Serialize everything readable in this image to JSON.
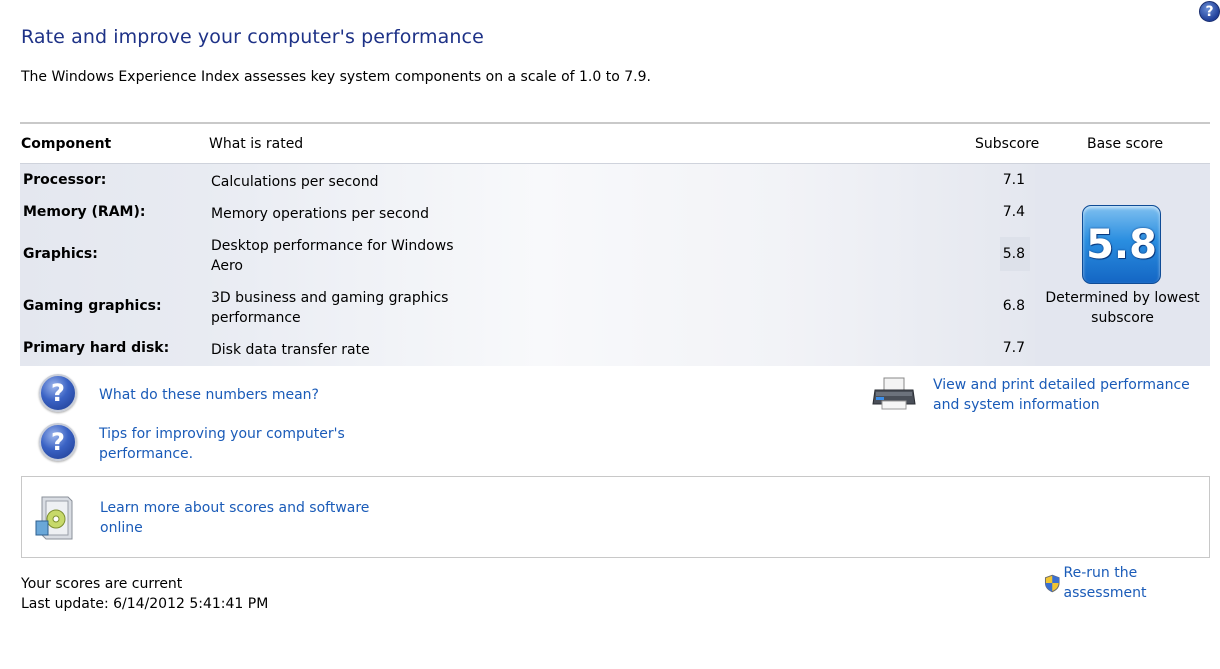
{
  "header": {
    "title": "Rate and improve your computer's performance",
    "subtitle": "The Windows Experience Index assesses key system components on a scale of 1.0 to 7.9."
  },
  "table": {
    "headers": {
      "component": "Component",
      "what_is_rated": "What is rated",
      "subscore": "Subscore",
      "base_score": "Base score"
    },
    "rows": [
      {
        "component": "Processor:",
        "what": "Calculations per second",
        "subscore": "7.1"
      },
      {
        "component": "Memory (RAM):",
        "what": "Memory operations per second",
        "subscore": "7.4"
      },
      {
        "component": "Graphics:",
        "what": "Desktop performance for Windows Aero",
        "subscore": "5.8"
      },
      {
        "component": "Gaming graphics:",
        "what": "3D business and gaming graphics performance",
        "subscore": "6.8"
      },
      {
        "component": "Primary hard disk:",
        "what": "Disk data transfer rate",
        "subscore": "7.7"
      }
    ],
    "base_score": "5.8",
    "base_note": "Determined by lowest subscore"
  },
  "links": {
    "numbers_meaning": "What do these numbers mean?",
    "tips": "Tips for improving your computer's performance.",
    "view_print": "View and print detailed performance and system information",
    "learn_more": "Learn more about scores and software online",
    "rerun": "Re-run the assessment"
  },
  "status": {
    "current": "Your scores are current",
    "last_update": "Last update: 6/14/2012 5:41:41 PM"
  },
  "icons": {
    "help": "help-icon",
    "question": "question-icon",
    "printer": "printer-icon",
    "software": "software-box-icon",
    "shield": "uac-shield-icon"
  },
  "colors": {
    "title": "#1e3287",
    "link": "#1a5bb8",
    "badge": "#2a8ee0"
  }
}
